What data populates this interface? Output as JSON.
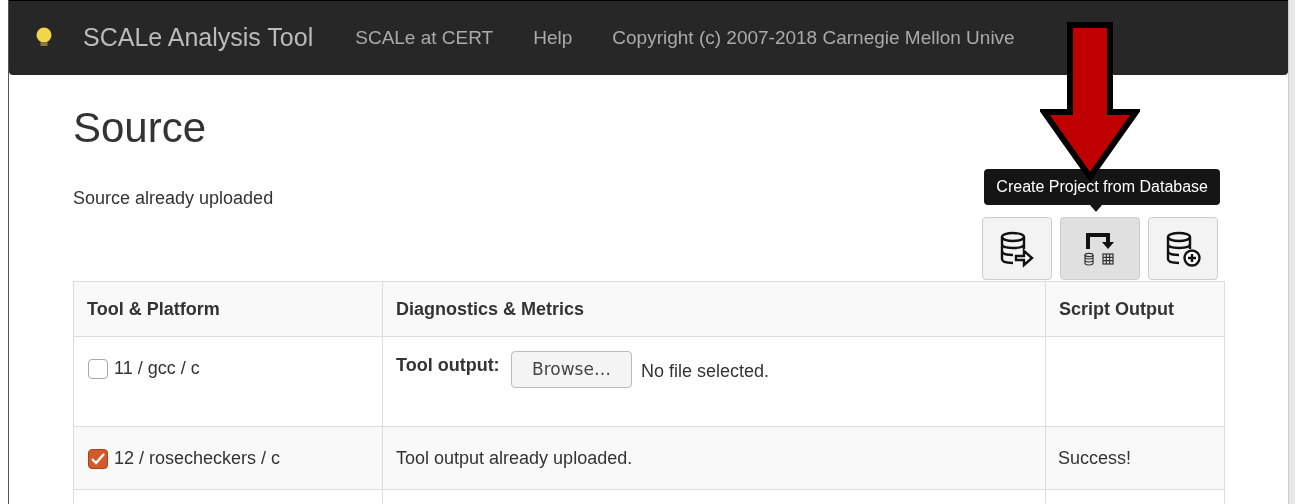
{
  "navbar": {
    "brand": "SCALe Analysis Tool",
    "links": [
      "SCALe at CERT",
      "Help",
      "Copyright (c) 2007-2018 Carnegie Mellon Unive"
    ]
  },
  "page": {
    "title": "Source",
    "status": "Source already uploaded"
  },
  "tooltip": "Create Project from Database",
  "toolbar": [
    {
      "kind": "export",
      "selected": false
    },
    {
      "kind": "create",
      "selected": true
    },
    {
      "kind": "add",
      "selected": false
    }
  ],
  "table": {
    "columns": [
      "Tool & Platform",
      "Diagnostics & Metrics",
      "Script Output"
    ],
    "rows": [
      {
        "kind": "upload",
        "checked": false,
        "tool": "11 / gcc / c",
        "label": "Tool output:",
        "button": "Browse…",
        "file": "No file selected."
      },
      {
        "kind": "status",
        "checked": true,
        "tool": "12 / rosecheckers / c",
        "message": "Tool output already uploaded.",
        "output": "Success!"
      }
    ]
  }
}
